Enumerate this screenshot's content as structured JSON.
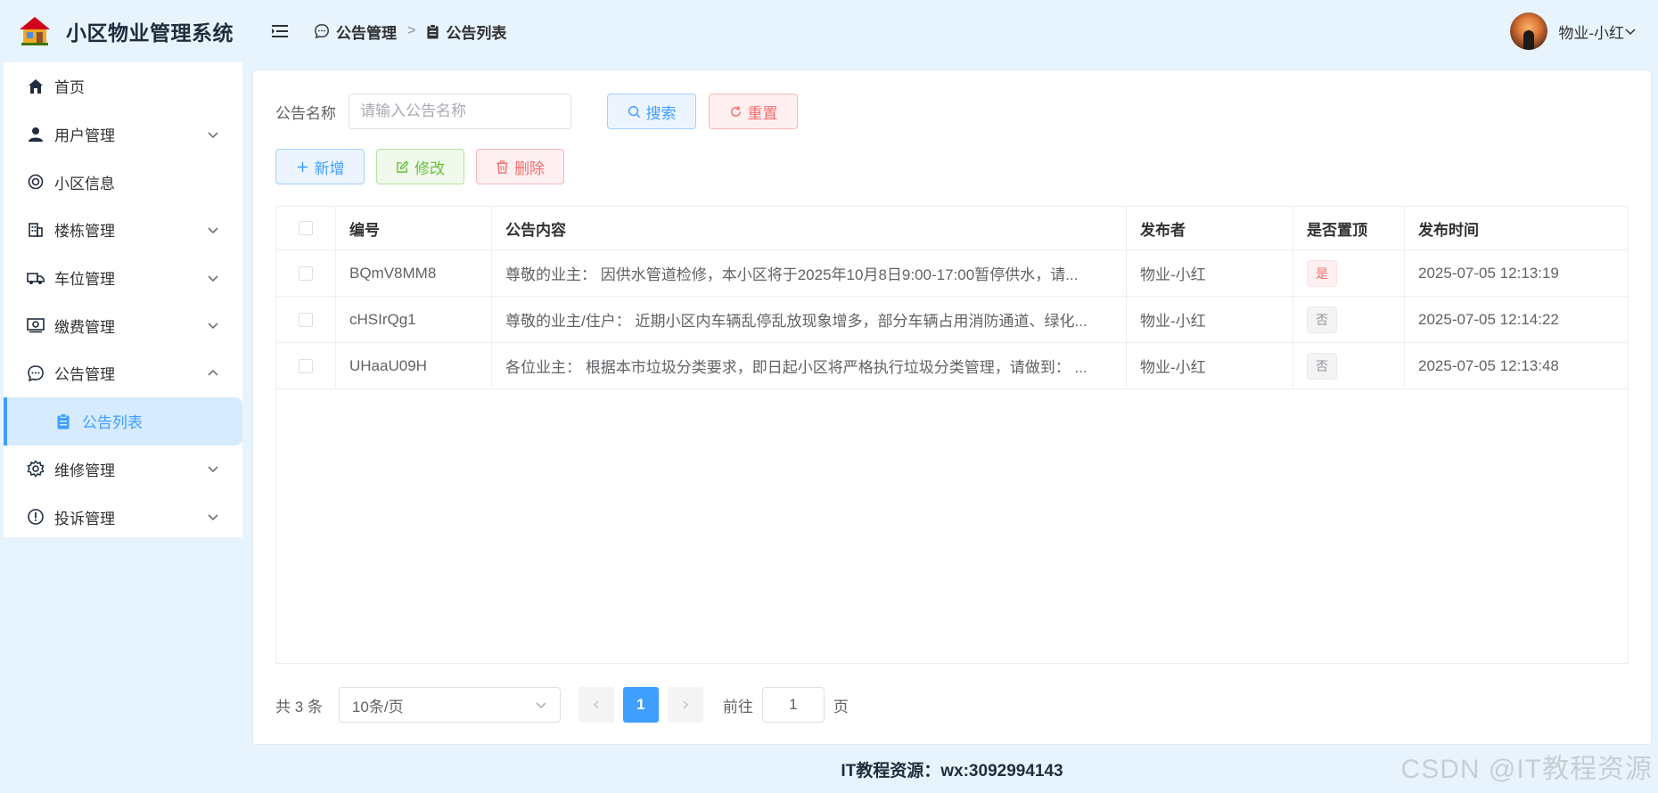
{
  "app": {
    "title": "小区物业管理系统"
  },
  "sidebar": {
    "items": [
      {
        "label": "首页"
      },
      {
        "label": "用户管理"
      },
      {
        "label": "小区信息"
      },
      {
        "label": "楼栋管理"
      },
      {
        "label": "车位管理"
      },
      {
        "label": "缴费管理"
      },
      {
        "label": "公告管理"
      },
      {
        "label": "公告列表"
      },
      {
        "label": "维修管理"
      },
      {
        "label": "投诉管理"
      }
    ]
  },
  "breadcrumb": {
    "parent": "公告管理",
    "current": "公告列表"
  },
  "user": {
    "name": "物业-小红"
  },
  "search": {
    "label": "公告名称",
    "placeholder": "请输入公告名称",
    "search_btn": "搜索",
    "reset_btn": "重置"
  },
  "actions": {
    "add": "新增",
    "edit": "修改",
    "delete": "删除"
  },
  "table": {
    "headers": {
      "id": "编号",
      "content": "公告内容",
      "publisher": "发布者",
      "top": "是否置顶",
      "time": "发布时间"
    },
    "rows": [
      {
        "id": "BQmV8MM8",
        "content": "尊敬的业主： 因供水管道检修，本小区将于2025年10月8日9:00-17:00暂停供水，请...",
        "publisher": "物业-小红",
        "top": "是",
        "time": "2025-07-05 12:13:19"
      },
      {
        "id": "cHSIrQg1",
        "content": "尊敬的业主/住户： 近期小区内车辆乱停乱放现象增多，部分车辆占用消防通道、绿化...",
        "publisher": "物业-小红",
        "top": "否",
        "time": "2025-07-05 12:14:22"
      },
      {
        "id": "UHaaU09H",
        "content": "各位业主： 根据本市垃圾分类要求，即日起小区将严格执行垃圾分类管理，请做到： ...",
        "publisher": "物业-小红",
        "top": "否",
        "time": "2025-07-05 12:13:48"
      }
    ]
  },
  "pagination": {
    "total": "共 3 条",
    "page_size": "10条/页",
    "current": "1",
    "goto_prefix": "前往",
    "goto_value": "1",
    "goto_suffix": "页"
  },
  "footer": {
    "text": "IT教程资源：wx:3092994143"
  },
  "watermark": {
    "text": "CSDN @IT教程资源"
  },
  "colors": {
    "primary": "#409eff",
    "danger": "#f56c6c",
    "success": "#67c23a",
    "background": "#e8f4fd"
  }
}
